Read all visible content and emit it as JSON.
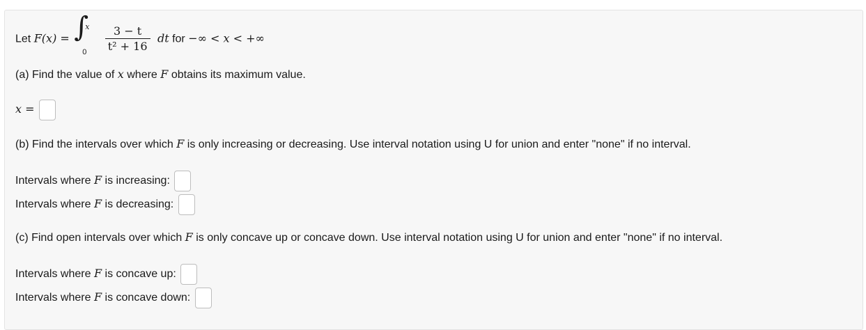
{
  "problem": {
    "intro_prefix": "Let",
    "fx": "F(x) =",
    "integral_upper": "x",
    "integral_lower": "0",
    "numerator": "3 − t",
    "denominator": "t² + 16",
    "dt": "dt",
    "for_word": "for",
    "domain": "−∞ < x < +∞"
  },
  "part_a": {
    "question_prefix": "(a) Find the value of",
    "var": "x",
    "question_mid": "where",
    "fvar": "F",
    "question_suffix": "obtains its maximum value.",
    "answer_label": "x ="
  },
  "part_b": {
    "question_prefix": "(b) Find the intervals over which",
    "fvar": "F",
    "question_suffix": "is only increasing or decreasing. Use interval notation using U for union and enter \"none\" if no interval.",
    "increasing_prefix": "Intervals where",
    "increasing_suffix": "is increasing:",
    "decreasing_prefix": "Intervals where",
    "decreasing_suffix": "is decreasing:"
  },
  "part_c": {
    "question_prefix": "(c) Find open intervals over which",
    "fvar": "F",
    "question_suffix": "is only concave up or concave down. Use interval notation using U for union and enter \"none\" if no interval.",
    "up_prefix": "Intervals where",
    "up_suffix": "is concave up:",
    "down_prefix": "Intervals where",
    "down_suffix": "is concave down:"
  }
}
